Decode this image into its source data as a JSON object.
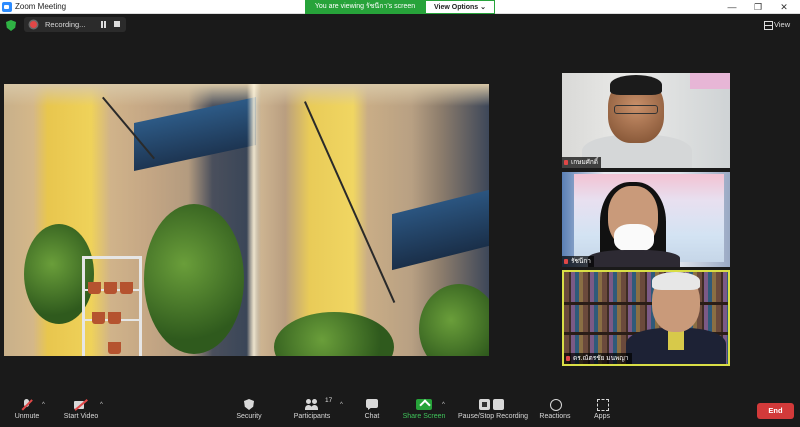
{
  "window": {
    "title": "Zoom Meeting",
    "controls": {
      "minimize": "—",
      "maximize": "❐",
      "close": "✕"
    }
  },
  "share_banner": {
    "viewing_text": "You are viewing รัชนีกา's screen",
    "view_options": "View Options ⌄"
  },
  "recording": {
    "label": "Recording..."
  },
  "view_button": {
    "label": "View"
  },
  "participants": [
    {
      "name": "เกษมศักดิ์"
    },
    {
      "name": "รัชนีกา"
    },
    {
      "name": "ดร.ณัตรชัย  มนพญา"
    }
  ],
  "toolbar": {
    "unmute": "Unmute",
    "start_video": "Start Video",
    "security": "Security",
    "participants": "Participants",
    "participants_count": "17",
    "chat": "Chat",
    "share_screen": "Share Screen",
    "pause_stop_recording": "Pause/Stop Recording",
    "reactions": "Reactions",
    "apps": "Apps",
    "end": "End"
  },
  "colors": {
    "share_green": "#27a33a",
    "end_red": "#d23a3a",
    "active_speaker_border": "#d9de46",
    "recording_dot": "#e04747"
  }
}
